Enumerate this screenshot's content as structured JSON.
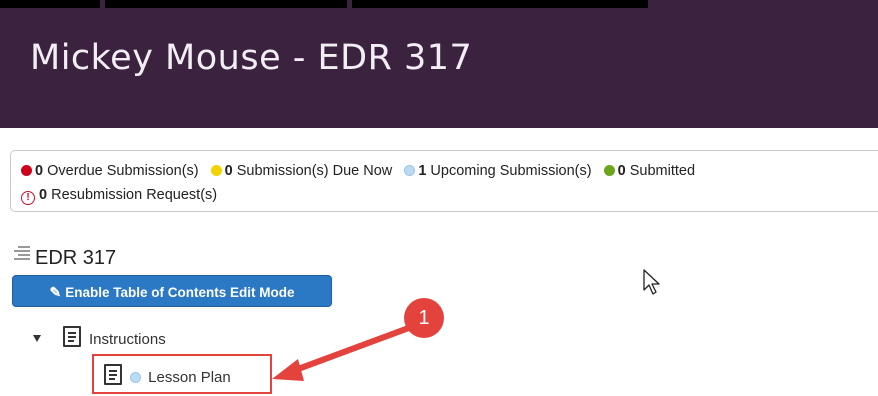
{
  "page": {
    "title": "Mickey Mouse - EDR 317"
  },
  "status": {
    "overdue": {
      "count": "0",
      "label": "Overdue Submission(s)"
    },
    "due_now": {
      "count": "0",
      "label": "Submission(s) Due Now"
    },
    "upcoming": {
      "count": "1",
      "label": "Upcoming Submission(s)"
    },
    "submitted": {
      "count": "0",
      "label": "Submitted"
    },
    "resubmission": {
      "count": "0",
      "label": "Resubmission Request(s)"
    }
  },
  "toc": {
    "heading": "EDR 317",
    "edit_button_label": "Enable Table of Contents Edit Mode",
    "items": [
      {
        "label": "Instructions"
      },
      {
        "label": "Lesson Plan"
      }
    ]
  },
  "annotation": {
    "step_number": "1"
  },
  "colors": {
    "header_bg": "#3b2340",
    "button_blue": "#2b78c5",
    "annotation_red": "#e3423d",
    "overdue": "#d0021b",
    "due_now": "#f2d200",
    "upcoming": "#b9dcf4",
    "submitted": "#6aa51c"
  },
  "icons": [
    "list-icon",
    "pencil-icon",
    "caret-down-icon",
    "document-icon",
    "status-dot-icon",
    "warning-icon",
    "cursor-icon",
    "arrow-icon"
  ]
}
